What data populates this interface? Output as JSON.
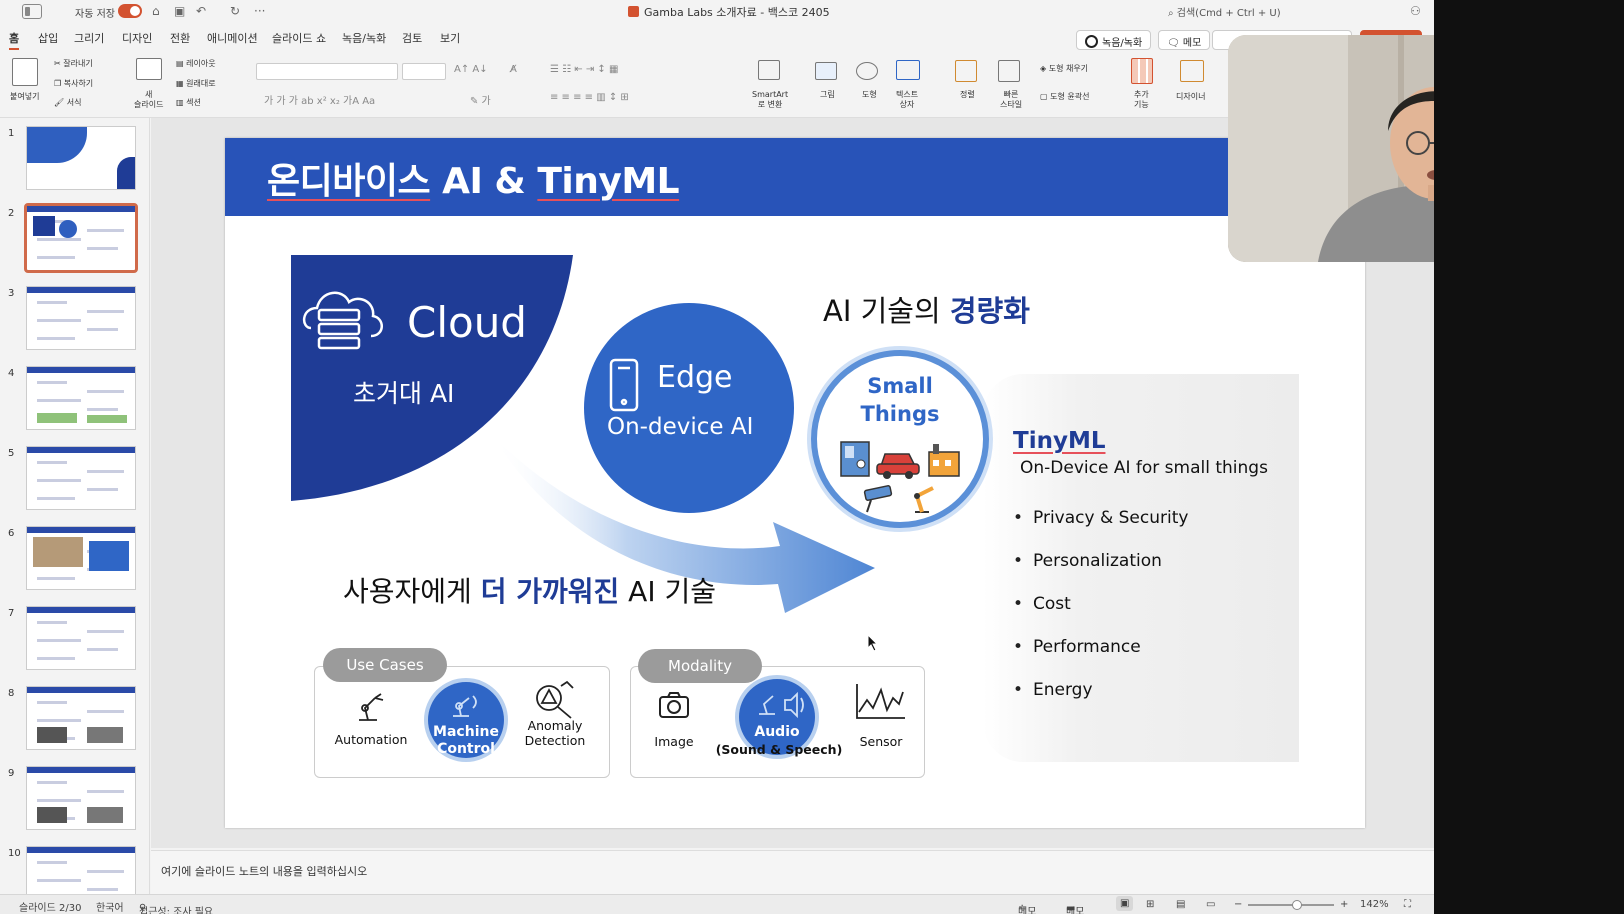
{
  "titlebar": {
    "autosave_label": "자동 저장",
    "doc_title": "Gamba Labs 소개자료 - 백스코 2405",
    "search_placeholder": "검색(Cmd + Ctrl + U)"
  },
  "tabs": [
    "홈",
    "삽입",
    "그리기",
    "디자인",
    "전환",
    "애니메이션",
    "슬라이드 쇼",
    "녹음/녹화",
    "검토",
    "보기"
  ],
  "tab_buttons": {
    "record": "녹음/녹화",
    "memo": "메모",
    "share": ""
  },
  "ribbon": {
    "paste": "붙여넣기",
    "cut": "잘라내기",
    "copy": "복사하기",
    "format": "서식",
    "new_slide": "새\n슬라이드",
    "layout": "레이아웃",
    "reset": "원래대로",
    "section": "섹션",
    "smartart": "SmartArt\n로 변환",
    "picture": "그림",
    "shapes": "도형",
    "textbox": "텍스트\n상자",
    "arrange": "정렬",
    "quick_styles": "빠른\n스타일",
    "shape_fill": "도형 채우기",
    "shape_outline": "도형 윤곽선",
    "addins": "추가\n기능",
    "designer": "디자이너"
  },
  "thumbnails": [
    1,
    2,
    3,
    4,
    5,
    6,
    7,
    8,
    9,
    10
  ],
  "selected_slide": 2,
  "slide": {
    "title_part1": "온디바이스",
    "title_part2": " AI & ",
    "title_part3": "TinyML",
    "cloud_title": "Cloud",
    "cloud_sub": "초거대 AI",
    "edge_title": "Edge",
    "edge_sub": "On-device AI",
    "small_things_1": "Small",
    "small_things_2": "Things",
    "headline_light_1": "AI 기술의 ",
    "headline_light_2": "경량화",
    "headline_closer_1": "사용자에게 ",
    "headline_closer_2": "더 가까워진",
    "headline_closer_3": " AI 기술",
    "tinyml_title": "TinyML",
    "tinyml_sub": "On-Device AI for small things",
    "tinyml_items": [
      "Privacy & Security",
      "Personalization",
      "Cost",
      "Performance",
      "Energy"
    ],
    "use_cases": {
      "pill": "Use Cases",
      "items": [
        "Automation",
        "Machine\nControl",
        "Anomaly\nDetection"
      ]
    },
    "modality": {
      "pill": "Modality",
      "items": [
        "Image",
        "Audio",
        "(Sound & Speech)",
        "Sensor"
      ]
    }
  },
  "notes_placeholder": "여기에 슬라이드 노트의 내용을 입력하십시오",
  "status": {
    "slide_pos": "슬라이드 2/30",
    "language": "한국어",
    "accessibility": "접근성: 조사 필요",
    "notes_btn": "메모",
    "comments_btn": "메모",
    "zoom": "142%"
  }
}
